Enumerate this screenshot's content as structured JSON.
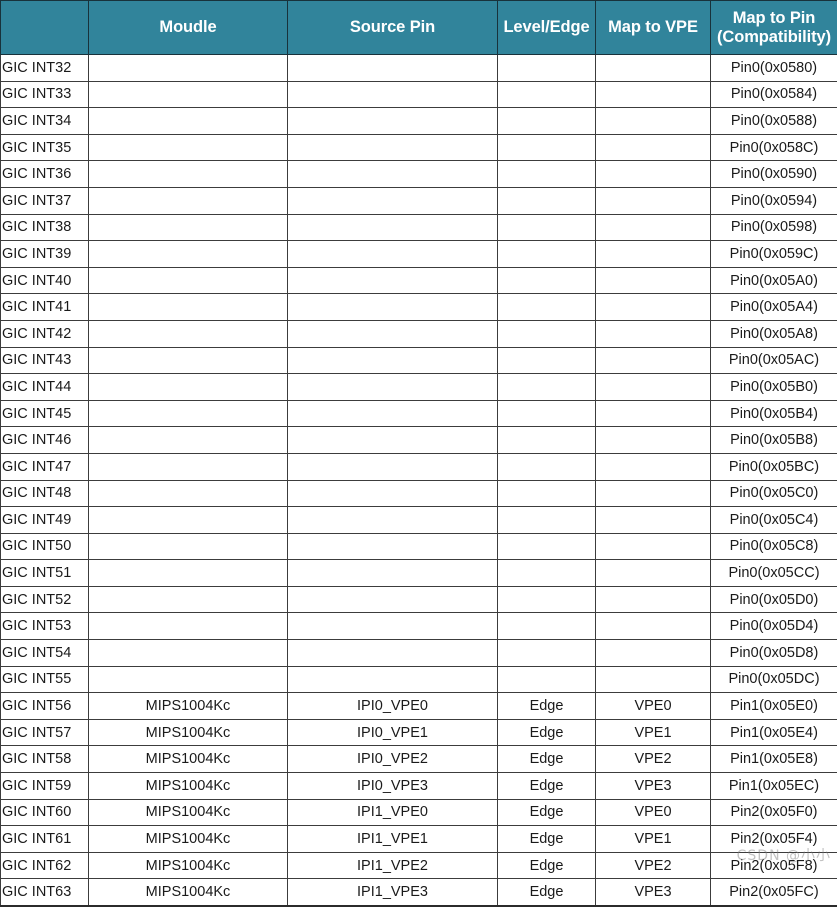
{
  "table": {
    "colors": {
      "header_background": "#31849B",
      "header_text": "#FFFFFF",
      "cell_border": "#3C3C3C",
      "cell_text": "#1A1A1A",
      "page_background": "#FFFFFF"
    },
    "columns": [
      {
        "key": "interrupt",
        "label": ""
      },
      {
        "key": "module",
        "label": "Moudle"
      },
      {
        "key": "source_pin",
        "label": "Source Pin"
      },
      {
        "key": "level_edge",
        "label": "Level/Edge"
      },
      {
        "key": "map_to_vpe",
        "label": "Map to VPE"
      },
      {
        "key": "map_to_pin",
        "label": "Map to Pin",
        "label_line2": "(Compatibility)"
      }
    ],
    "rows": [
      {
        "interrupt": "GIC INT32",
        "module": "",
        "source_pin": "",
        "level_edge": "",
        "map_to_vpe": "",
        "map_to_pin": "Pin0(0x0580)"
      },
      {
        "interrupt": "GIC INT33",
        "module": "",
        "source_pin": "",
        "level_edge": "",
        "map_to_vpe": "",
        "map_to_pin": "Pin0(0x0584)"
      },
      {
        "interrupt": "GIC INT34",
        "module": "",
        "source_pin": "",
        "level_edge": "",
        "map_to_vpe": "",
        "map_to_pin": "Pin0(0x0588)"
      },
      {
        "interrupt": "GIC INT35",
        "module": "",
        "source_pin": "",
        "level_edge": "",
        "map_to_vpe": "",
        "map_to_pin": "Pin0(0x058C)"
      },
      {
        "interrupt": "GIC INT36",
        "module": "",
        "source_pin": "",
        "level_edge": "",
        "map_to_vpe": "",
        "map_to_pin": "Pin0(0x0590)"
      },
      {
        "interrupt": "GIC INT37",
        "module": "",
        "source_pin": "",
        "level_edge": "",
        "map_to_vpe": "",
        "map_to_pin": "Pin0(0x0594)"
      },
      {
        "interrupt": "GIC INT38",
        "module": "",
        "source_pin": "",
        "level_edge": "",
        "map_to_vpe": "",
        "map_to_pin": "Pin0(0x0598)"
      },
      {
        "interrupt": "GIC INT39",
        "module": "",
        "source_pin": "",
        "level_edge": "",
        "map_to_vpe": "",
        "map_to_pin": "Pin0(0x059C)"
      },
      {
        "interrupt": "GIC INT40",
        "module": "",
        "source_pin": "",
        "level_edge": "",
        "map_to_vpe": "",
        "map_to_pin": "Pin0(0x05A0)"
      },
      {
        "interrupt": "GIC INT41",
        "module": "",
        "source_pin": "",
        "level_edge": "",
        "map_to_vpe": "",
        "map_to_pin": "Pin0(0x05A4)"
      },
      {
        "interrupt": "GIC INT42",
        "module": "",
        "source_pin": "",
        "level_edge": "",
        "map_to_vpe": "",
        "map_to_pin": "Pin0(0x05A8)"
      },
      {
        "interrupt": "GIC INT43",
        "module": "",
        "source_pin": "",
        "level_edge": "",
        "map_to_vpe": "",
        "map_to_pin": "Pin0(0x05AC)"
      },
      {
        "interrupt": "GIC INT44",
        "module": "",
        "source_pin": "",
        "level_edge": "",
        "map_to_vpe": "",
        "map_to_pin": "Pin0(0x05B0)"
      },
      {
        "interrupt": "GIC INT45",
        "module": "",
        "source_pin": "",
        "level_edge": "",
        "map_to_vpe": "",
        "map_to_pin": "Pin0(0x05B4)"
      },
      {
        "interrupt": "GIC INT46",
        "module": "",
        "source_pin": "",
        "level_edge": "",
        "map_to_vpe": "",
        "map_to_pin": "Pin0(0x05B8)"
      },
      {
        "interrupt": "GIC INT47",
        "module": "",
        "source_pin": "",
        "level_edge": "",
        "map_to_vpe": "",
        "map_to_pin": "Pin0(0x05BC)"
      },
      {
        "interrupt": "GIC INT48",
        "module": "",
        "source_pin": "",
        "level_edge": "",
        "map_to_vpe": "",
        "map_to_pin": "Pin0(0x05C0)"
      },
      {
        "interrupt": "GIC INT49",
        "module": "",
        "source_pin": "",
        "level_edge": "",
        "map_to_vpe": "",
        "map_to_pin": "Pin0(0x05C4)"
      },
      {
        "interrupt": "GIC INT50",
        "module": "",
        "source_pin": "",
        "level_edge": "",
        "map_to_vpe": "",
        "map_to_pin": "Pin0(0x05C8)"
      },
      {
        "interrupt": "GIC INT51",
        "module": "",
        "source_pin": "",
        "level_edge": "",
        "map_to_vpe": "",
        "map_to_pin": "Pin0(0x05CC)"
      },
      {
        "interrupt": "GIC INT52",
        "module": "",
        "source_pin": "",
        "level_edge": "",
        "map_to_vpe": "",
        "map_to_pin": "Pin0(0x05D0)"
      },
      {
        "interrupt": "GIC INT53",
        "module": "",
        "source_pin": "",
        "level_edge": "",
        "map_to_vpe": "",
        "map_to_pin": "Pin0(0x05D4)"
      },
      {
        "interrupt": "GIC INT54",
        "module": "",
        "source_pin": "",
        "level_edge": "",
        "map_to_vpe": "",
        "map_to_pin": "Pin0(0x05D8)"
      },
      {
        "interrupt": "GIC INT55",
        "module": "",
        "source_pin": "",
        "level_edge": "",
        "map_to_vpe": "",
        "map_to_pin": "Pin0(0x05DC)"
      },
      {
        "interrupt": "GIC INT56",
        "module": "MIPS1004Kc",
        "source_pin": "IPI0_VPE0",
        "level_edge": "Edge",
        "map_to_vpe": "VPE0",
        "map_to_pin": "Pin1(0x05E0)"
      },
      {
        "interrupt": "GIC INT57",
        "module": "MIPS1004Kc",
        "source_pin": "IPI0_VPE1",
        "level_edge": "Edge",
        "map_to_vpe": "VPE1",
        "map_to_pin": "Pin1(0x05E4)"
      },
      {
        "interrupt": "GIC INT58",
        "module": "MIPS1004Kc",
        "source_pin": "IPI0_VPE2",
        "level_edge": "Edge",
        "map_to_vpe": "VPE2",
        "map_to_pin": "Pin1(0x05E8)"
      },
      {
        "interrupt": "GIC INT59",
        "module": "MIPS1004Kc",
        "source_pin": "IPI0_VPE3",
        "level_edge": "Edge",
        "map_to_vpe": "VPE3",
        "map_to_pin": "Pin1(0x05EC)"
      },
      {
        "interrupt": "GIC INT60",
        "module": "MIPS1004Kc",
        "source_pin": "IPI1_VPE0",
        "level_edge": "Edge",
        "map_to_vpe": "VPE0",
        "map_to_pin": "Pin2(0x05F0)"
      },
      {
        "interrupt": "GIC INT61",
        "module": "MIPS1004Kc",
        "source_pin": "IPI1_VPE1",
        "level_edge": "Edge",
        "map_to_vpe": "VPE1",
        "map_to_pin": "Pin2(0x05F4)"
      },
      {
        "interrupt": "GIC INT62",
        "module": "MIPS1004Kc",
        "source_pin": "IPI1_VPE2",
        "level_edge": "Edge",
        "map_to_vpe": "VPE2",
        "map_to_pin": "Pin2(0x05F8)"
      },
      {
        "interrupt": "GIC INT63",
        "module": "MIPS1004Kc",
        "source_pin": "IPI1_VPE3",
        "level_edge": "Edge",
        "map_to_vpe": "VPE3",
        "map_to_pin": "Pin2(0x05FC)"
      }
    ]
  },
  "watermark": {
    "text": "CSDN @小小"
  }
}
